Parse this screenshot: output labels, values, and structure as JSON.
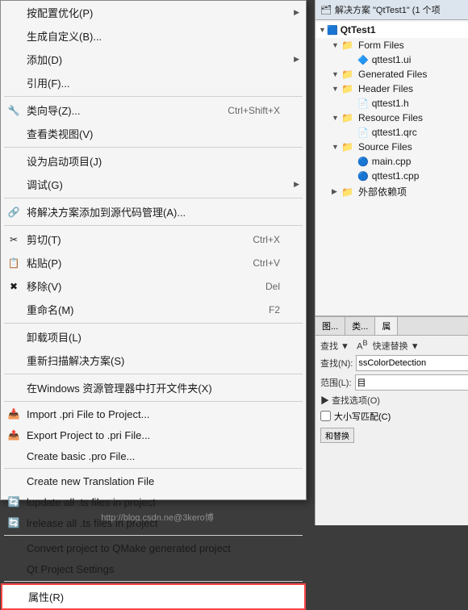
{
  "contextMenu": {
    "items": [
      {
        "id": "configure-optimize",
        "label": "按配置优化(P)",
        "shortcut": "",
        "hasSubmenu": true,
        "icon": "",
        "separator_after": false
      },
      {
        "id": "generate-define",
        "label": "生成自定义(B)...",
        "shortcut": "",
        "hasSubmenu": false,
        "icon": "",
        "separator_after": false
      },
      {
        "id": "add",
        "label": "添加(D)",
        "shortcut": "",
        "hasSubmenu": true,
        "icon": "",
        "separator_after": false
      },
      {
        "id": "import",
        "label": "引用(F)...",
        "shortcut": "",
        "hasSubmenu": false,
        "icon": "",
        "separator_after": true
      },
      {
        "id": "class-wizard",
        "label": "类向导(Z)...",
        "shortcut": "Ctrl+Shift+X",
        "hasSubmenu": false,
        "icon": "wizard",
        "separator_after": false
      },
      {
        "id": "view-class",
        "label": "查看类视图(V)",
        "shortcut": "",
        "hasSubmenu": false,
        "icon": "",
        "separator_after": true
      },
      {
        "id": "set-startup",
        "label": "设为启动项目(J)",
        "shortcut": "",
        "hasSubmenu": false,
        "icon": "",
        "separator_after": false
      },
      {
        "id": "debug",
        "label": "调试(G)",
        "shortcut": "",
        "hasSubmenu": true,
        "icon": "",
        "separator_after": true
      },
      {
        "id": "add-to-source-ctrl",
        "label": "将解决方案添加到源代码管理(A)...",
        "shortcut": "",
        "hasSubmenu": false,
        "icon": "source",
        "separator_after": true
      },
      {
        "id": "cut",
        "label": "剪切(T)",
        "shortcut": "Ctrl+X",
        "hasSubmenu": false,
        "icon": "cut",
        "separator_after": false
      },
      {
        "id": "paste",
        "label": "粘贴(P)",
        "shortcut": "Ctrl+V",
        "hasSubmenu": false,
        "icon": "paste",
        "separator_after": false
      },
      {
        "id": "remove",
        "label": "移除(V)",
        "shortcut": "Del",
        "hasSubmenu": false,
        "icon": "remove",
        "separator_after": false
      },
      {
        "id": "rename",
        "label": "重命名(M)",
        "shortcut": "F2",
        "hasSubmenu": false,
        "icon": "",
        "separator_after": true
      },
      {
        "id": "unload",
        "label": "卸载项目(L)",
        "shortcut": "",
        "hasSubmenu": false,
        "icon": "",
        "separator_after": false
      },
      {
        "id": "rescan",
        "label": "重新扫描解决方案(S)",
        "shortcut": "",
        "hasSubmenu": false,
        "icon": "",
        "separator_after": true
      },
      {
        "id": "open-in-explorer",
        "label": "在Windows 资源管理器中打开文件夹(X)",
        "shortcut": "",
        "hasSubmenu": false,
        "icon": "",
        "separator_after": true
      },
      {
        "id": "import-pri",
        "label": "Import .pri File to Project...",
        "shortcut": "",
        "hasSubmenu": false,
        "icon": "pri-import",
        "separator_after": false
      },
      {
        "id": "export-pri",
        "label": "Export Project to .pri File...",
        "shortcut": "",
        "hasSubmenu": false,
        "icon": "pri-export",
        "separator_after": false
      },
      {
        "id": "create-pro",
        "label": "Create basic .pro File...",
        "shortcut": "",
        "hasSubmenu": false,
        "icon": "",
        "separator_after": true
      },
      {
        "id": "create-translation",
        "label": "Create new Translation File",
        "shortcut": "",
        "hasSubmenu": false,
        "icon": "",
        "separator_after": false
      },
      {
        "id": "lupdate-ts",
        "label": "lupdate all .ts files in project",
        "shortcut": "",
        "hasSubmenu": false,
        "icon": "lupdate",
        "separator_after": false
      },
      {
        "id": "lrelease-ts",
        "label": "lrelease all .ts files in project",
        "shortcut": "",
        "hasSubmenu": false,
        "icon": "lrelease",
        "separator_after": true
      },
      {
        "id": "convert-qmake",
        "label": "Convert project to QMake generated project",
        "shortcut": "",
        "hasSubmenu": false,
        "icon": "",
        "separator_after": false
      },
      {
        "id": "qt-project-settings",
        "label": "Qt Project Settings",
        "shortcut": "",
        "hasSubmenu": false,
        "icon": "",
        "separator_after": true
      },
      {
        "id": "properties",
        "label": "属性(R)",
        "shortcut": "",
        "hasSubmenu": false,
        "icon": "",
        "separator_after": false,
        "highlighted": true
      }
    ]
  },
  "solutionExplorer": {
    "title": "解决方案 \"QtTest1\" (1 个项",
    "rootNode": "QtTest1",
    "nodes": [
      {
        "type": "folder",
        "label": "Form Files",
        "level": 1,
        "expanded": true
      },
      {
        "type": "file",
        "label": "qttest1.ui",
        "level": 2,
        "fileType": "ui"
      },
      {
        "type": "folder",
        "label": "Generated Files",
        "level": 1,
        "expanded": true
      },
      {
        "type": "folder",
        "label": "Header Files",
        "level": 1,
        "expanded": true
      },
      {
        "type": "file",
        "label": "qttest1.h",
        "level": 2,
        "fileType": "h"
      },
      {
        "type": "folder",
        "label": "Resource Files",
        "level": 1,
        "expanded": true
      },
      {
        "type": "file",
        "label": "qttest1.qrc",
        "level": 2,
        "fileType": "qrc"
      },
      {
        "type": "folder",
        "label": "Source Files",
        "level": 1,
        "expanded": true
      },
      {
        "type": "file",
        "label": "main.cpp",
        "level": 2,
        "fileType": "cpp"
      },
      {
        "type": "file",
        "label": "qttest1.cpp",
        "level": 2,
        "fileType": "cpp"
      },
      {
        "type": "folder",
        "label": "外部依赖项",
        "level": 1,
        "expanded": false
      }
    ]
  },
  "searchReplace": {
    "tabs": [
      "图...",
      "类...",
      "属"
    ],
    "activeTab": 2,
    "searchLabel": "查找(N):",
    "searchValue": "ssColorDetection",
    "replaceLabel": "范围(L):",
    "replaceValue": "目",
    "optionsLabel": "查找选项(O)",
    "matchCase": "大小写匹配(C)",
    "replaceAll": "和替换"
  },
  "toolbar": {
    "icons": [
      "↕"
    ]
  },
  "watermark": "http://blog.csdn.ne@3kero博"
}
